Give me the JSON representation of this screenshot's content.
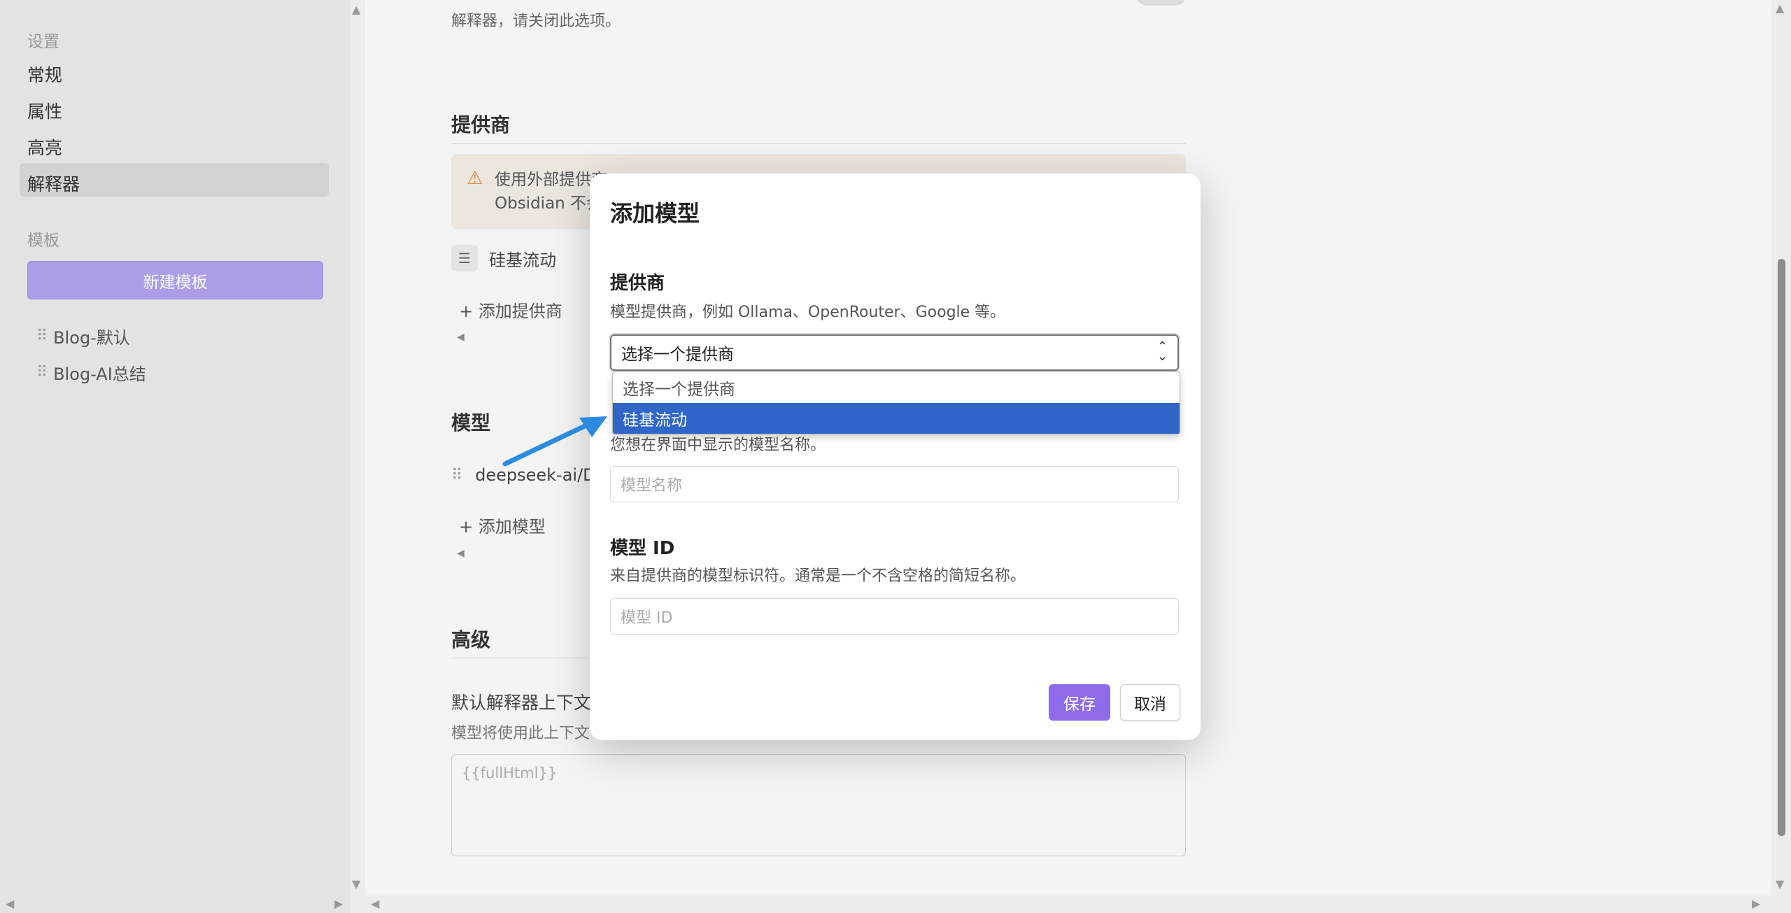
{
  "sidebar": {
    "settings_heading": "设置",
    "items": [
      {
        "label": "常规"
      },
      {
        "label": "属性"
      },
      {
        "label": "高亮"
      },
      {
        "label": "解释器"
      }
    ],
    "templates_heading": "模板",
    "new_template_label": "新建模板",
    "templates": [
      {
        "label": "Blog-默认"
      },
      {
        "label": "Blog-AI总结"
      }
    ]
  },
  "main": {
    "top_text": "解释器，请关闭此选项。",
    "providers_title": "提供商",
    "warning_line1": "使用外部提供商",
    "warning_line2": "Obsidian 不会",
    "provider_name": "硅基流动",
    "add_provider_label": "+ 添加提供商",
    "models_title": "模型",
    "model_name": "deepseek-ai/De",
    "add_model_label": "+ 添加模型",
    "advanced_title": "高级",
    "context_label": "默认解释器上下文",
    "context_desc": "模型将使用此上下文",
    "context_placeholder": "{{fullHtml}}"
  },
  "modal": {
    "title": "添加模型",
    "provider_label": "提供商",
    "provider_desc": "模型提供商，例如 Ollama、OpenRouter、Google 等。",
    "provider_selected": "选择一个提供商",
    "name_desc": "您想在界面中显示的模型名称。",
    "name_placeholder": "模型名称",
    "id_label": "模型 ID",
    "id_desc": "来自提供商的模型标识符。通常是一个不含空格的简短名称。",
    "id_placeholder": "模型 ID",
    "save_label": "保存",
    "cancel_label": "取消"
  },
  "dropdown": {
    "options": [
      {
        "label": "选择一个提供商"
      },
      {
        "label": "硅基流动"
      }
    ]
  },
  "colors": {
    "accent": "#8e6be8",
    "new_template_button": "#ab9de8",
    "dropdown_highlight": "#2f66c8",
    "callout_arrow": "#2a8be0",
    "warning": "#d98840"
  }
}
